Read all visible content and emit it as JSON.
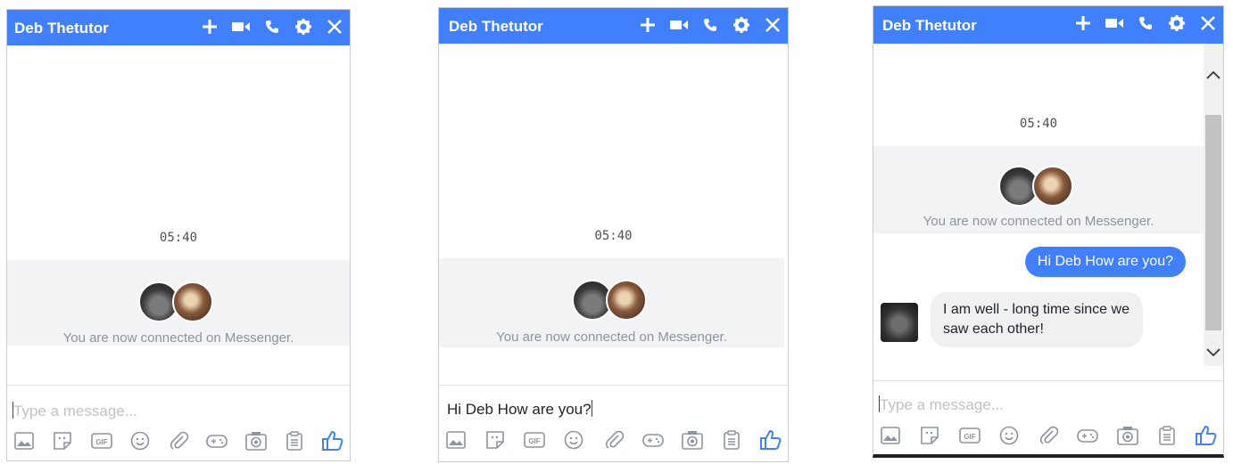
{
  "windows": [
    {
      "title": "Deb Thetutor",
      "timestamp": "05:40",
      "connected_text": "You are now connected on Messenger.",
      "input_placeholder": "Type a message...",
      "input_value": ""
    },
    {
      "title": "Deb Thetutor",
      "timestamp": "05:40",
      "connected_text": "You are now connected on Messenger.",
      "input_placeholder": "Type a message...",
      "input_value": "Hi Deb How are you?"
    },
    {
      "title": "Deb Thetutor",
      "timestamp": "05:40",
      "connected_text": "You are now connected on Messenger.",
      "input_placeholder": "Type a message...",
      "input_value": "",
      "messages": [
        {
          "from": "me",
          "text": "Hi Deb How are you?"
        },
        {
          "from": "them",
          "text": "I am well - long time since we saw each other!"
        }
      ]
    }
  ],
  "header_icons": [
    "plus-icon",
    "video-camera-icon",
    "phone-icon",
    "gear-icon",
    "close-icon"
  ],
  "toolbar_icons": [
    "photo-icon",
    "sticker-icon",
    "gif-icon",
    "emoji-icon",
    "attachment-icon",
    "game-icon",
    "camera-icon",
    "clipboard-icon",
    "thumbs-up-icon"
  ],
  "colors": {
    "accent": "#4080ff",
    "band": "#f2f3f5",
    "bubble_them": "#f1f0f0"
  }
}
